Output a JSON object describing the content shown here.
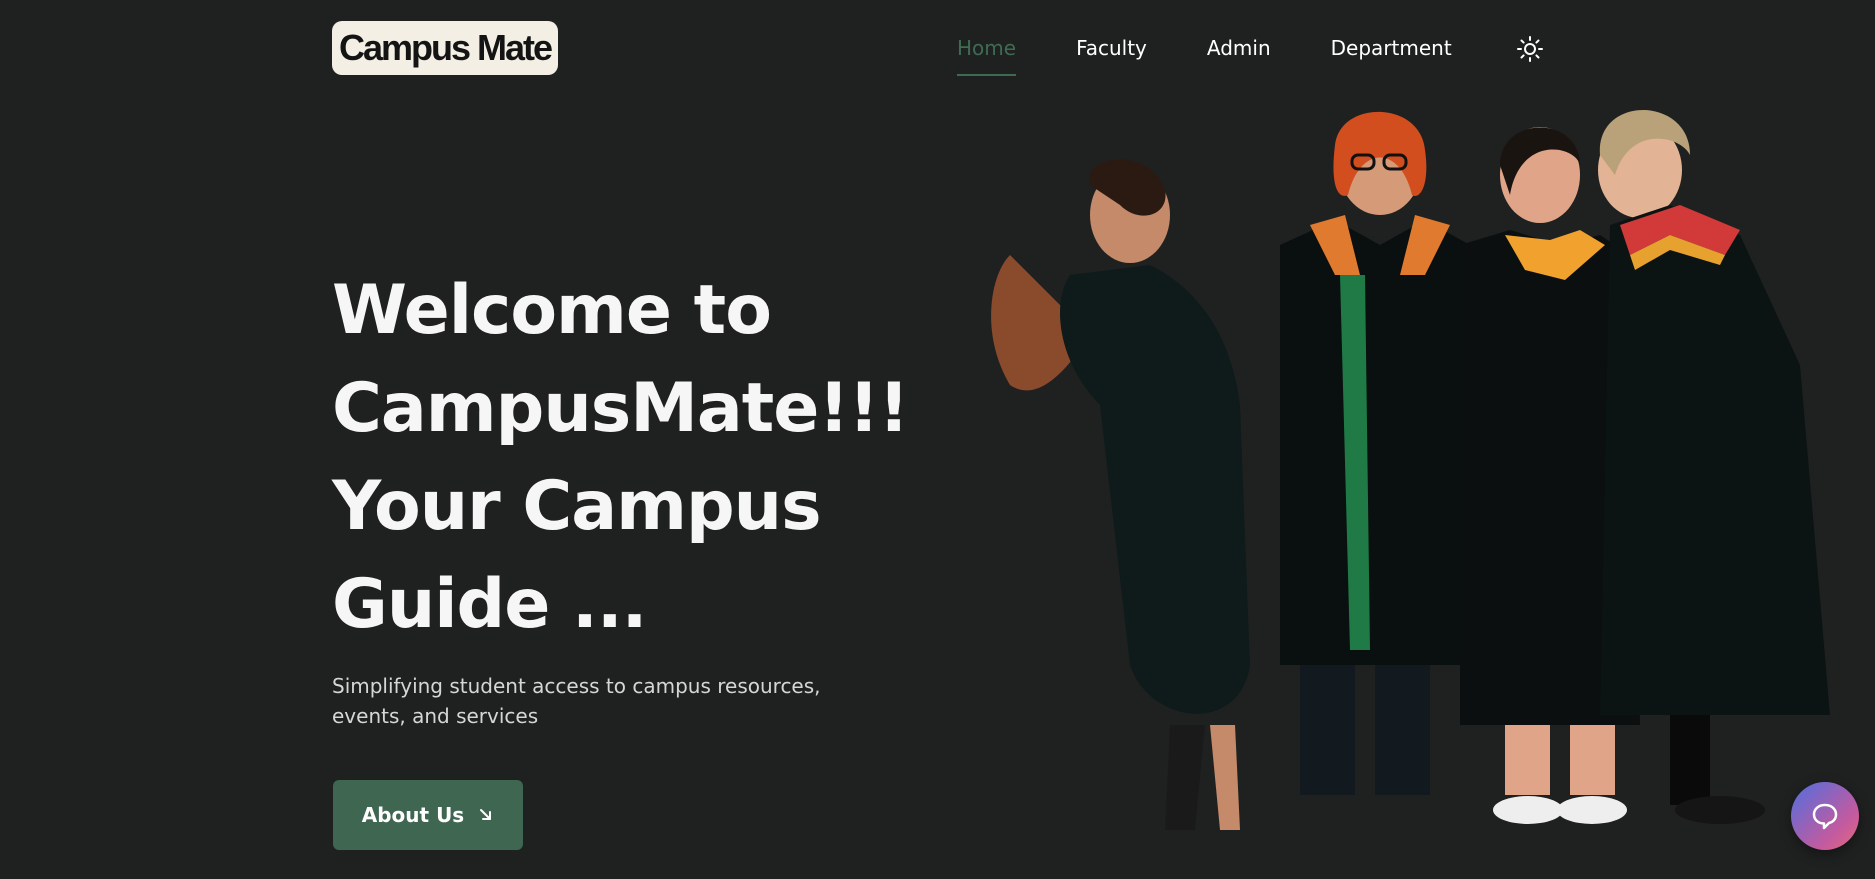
{
  "brand": {
    "logo_text": "Campus Mate"
  },
  "nav": {
    "items": [
      {
        "label": "Home",
        "active": true
      },
      {
        "label": "Faculty",
        "active": false
      },
      {
        "label": "Admin",
        "active": false
      },
      {
        "label": "Department",
        "active": false
      }
    ],
    "theme_toggle_icon": "sun-icon"
  },
  "hero": {
    "title_lines": [
      "Welcome to",
      "CampusMate!!!",
      "Your Campus",
      "Guide ..."
    ],
    "subtitle": "Simplifying student access to campus resources, events, and services",
    "cta_label": "About Us",
    "cta_icon": "arrow-down-right-icon",
    "image_icon": "graduates-photo"
  },
  "chat": {
    "icon": "chat-bubble-icon"
  },
  "colors": {
    "background": "#1f2120",
    "accent": "#3f6b53",
    "button": "#3e6650",
    "text": "#ffffff",
    "logo_bg": "#f3efe4"
  }
}
